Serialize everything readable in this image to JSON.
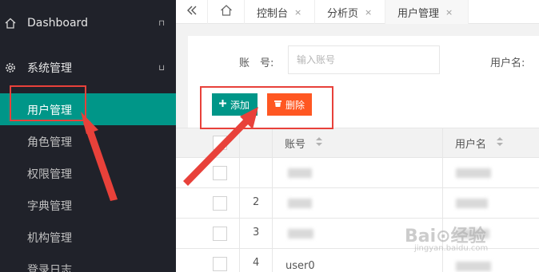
{
  "sidebar": {
    "dashboard_label": "Dashboard",
    "system_label": "系统管理",
    "items": [
      {
        "label": "用户管理",
        "active": true
      },
      {
        "label": "角色管理"
      },
      {
        "label": "权限管理"
      },
      {
        "label": "字典管理"
      },
      {
        "label": "机构管理"
      },
      {
        "label": "登录日志"
      }
    ]
  },
  "tabs": {
    "collapse_icon": "double-chevron-left-icon",
    "home_icon": "home-icon",
    "items": [
      {
        "label": "控制台"
      },
      {
        "label": "分析页"
      },
      {
        "label": "用户管理",
        "active": true
      }
    ],
    "close_glyph": "×"
  },
  "search": {
    "account_label": "账　号:",
    "account_placeholder": "输入账号",
    "username_label": "用户名:"
  },
  "toolbar": {
    "add_label": "添加",
    "delete_label": "删除",
    "add_color": "#009688",
    "delete_color": "#ff5722"
  },
  "table": {
    "headers": {
      "account": "账号",
      "username": "用户名"
    },
    "rows": [
      {
        "no": ""
      },
      {
        "no": "2"
      },
      {
        "no": "3"
      },
      {
        "no": "4",
        "account_prefix": "user0"
      }
    ]
  },
  "watermark": {
    "main": "Bai⊙经验",
    "sub": "jingyan.baidu.com"
  },
  "colors": {
    "sidebar_bg": "#20222a",
    "accent": "#009688",
    "annotation": "#e8413a"
  }
}
